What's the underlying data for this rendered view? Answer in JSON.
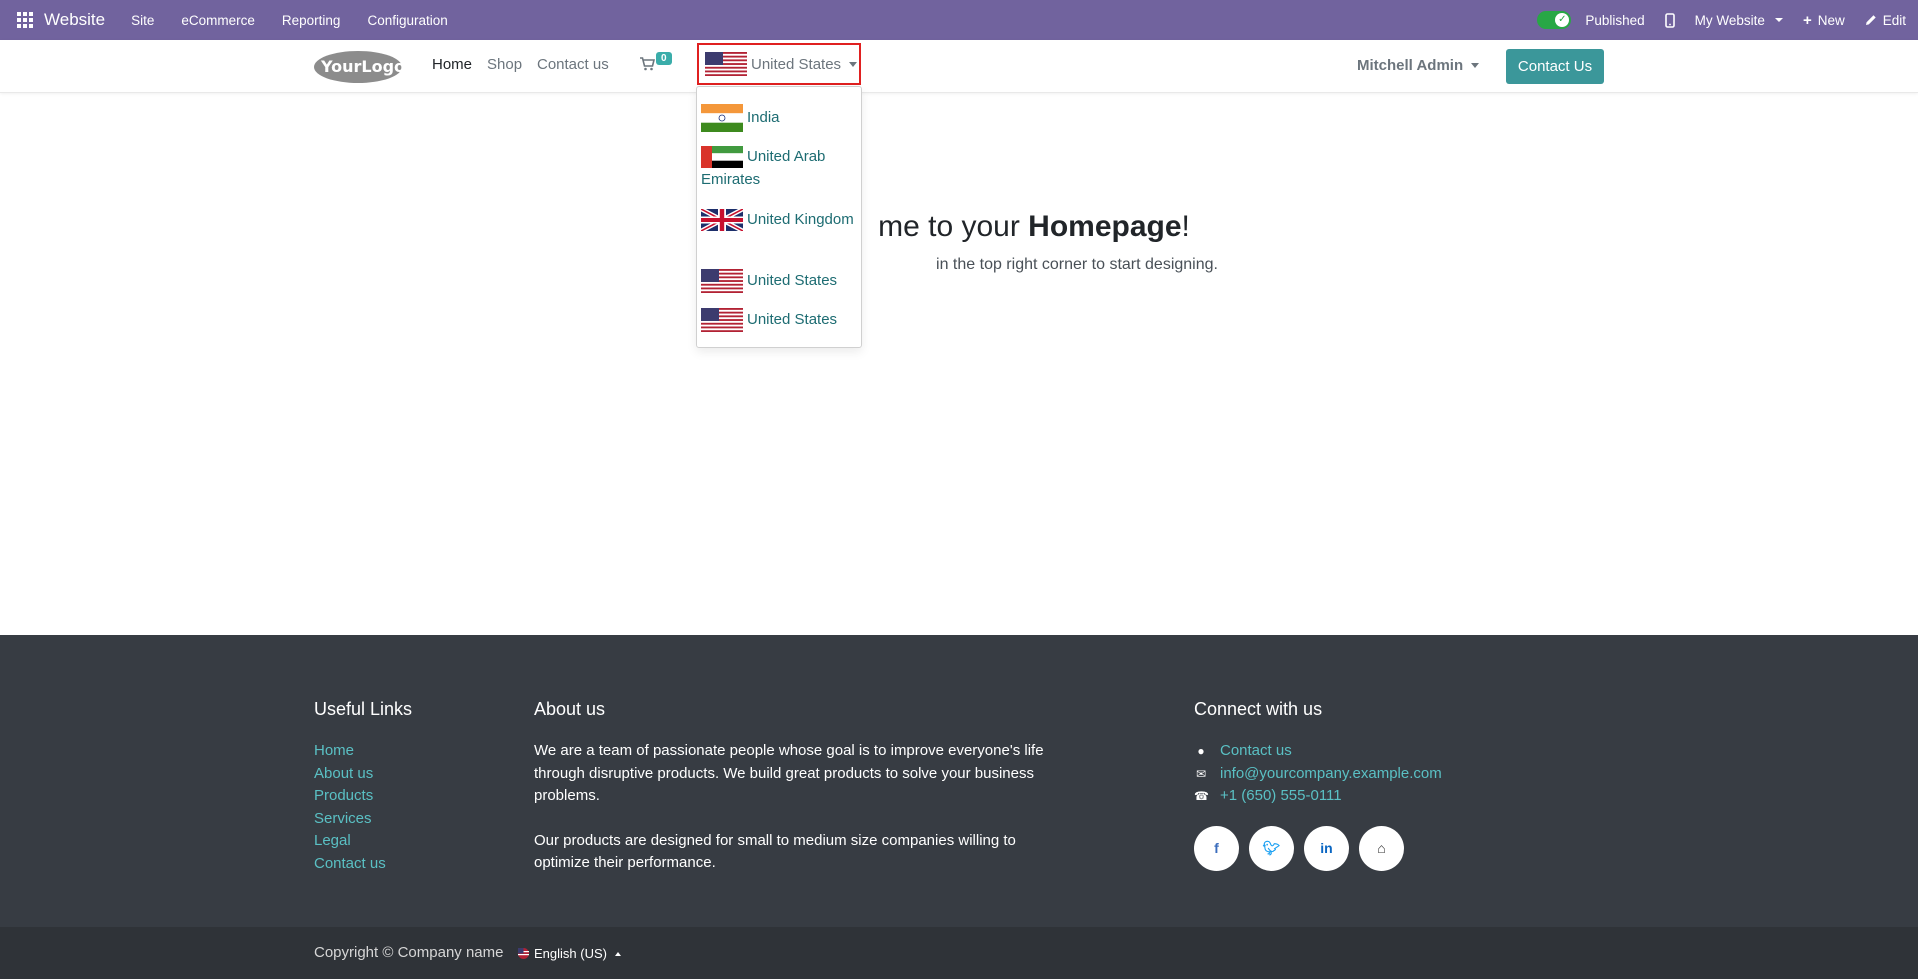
{
  "admin_bar": {
    "app_name": "Website",
    "menu": [
      "Site",
      "eCommerce",
      "Reporting",
      "Configuration"
    ],
    "published_label": "Published",
    "website_label": "My Website",
    "new_label": "New",
    "edit_label": "Edit"
  },
  "header": {
    "logo_text": "YourLogo",
    "nav": [
      "Home",
      "Shop",
      "Contact us"
    ],
    "cart_count": "0",
    "country_selected": "United States",
    "user_name": "Mitchell Admin",
    "contact_button": "Contact Us"
  },
  "country_dropdown": {
    "items": [
      {
        "label": "India",
        "flag": "india-flag-icon"
      },
      {
        "label": "United Arab Emirates",
        "flag": "uae-flag-icon"
      },
      {
        "label": "United Kingdom",
        "flag": "uk-flag-icon"
      },
      {
        "label": "United States",
        "flag": "us-flag-icon"
      },
      {
        "label": "United States",
        "flag": "us-flag-icon"
      }
    ]
  },
  "hero": {
    "title_prefix": "me to your ",
    "title_bold": "Homepage",
    "title_suffix": "!",
    "subtitle": "in the top right corner to start designing."
  },
  "footer": {
    "useful_links_title": "Useful Links",
    "useful_links": [
      "Home",
      "About us",
      "Products",
      "Services",
      "Legal",
      "Contact us"
    ],
    "about_title": "About us",
    "about_p1": "We are a team of passionate people whose goal is to improve everyone's life through disruptive products. We build great products to solve your business problems.",
    "about_p2": "Our products are designed for small to medium size companies willing to optimize their performance.",
    "connect_title": "Connect with us",
    "contact_link": "Contact us",
    "email": "info@yourcompany.example.com",
    "phone": "+1 (650) 555-0111",
    "socials": [
      "facebook-icon",
      "twitter-icon",
      "linkedin-icon",
      "home-icon"
    ]
  },
  "copyright": {
    "text": "Copyright © Company name",
    "language": "English (US)"
  },
  "colors": {
    "admin_bar": "#71639e",
    "primary": "#3b979a",
    "link": "#1d6c72",
    "footer_bg": "#373c43",
    "footer_link": "#5ac0c4"
  }
}
